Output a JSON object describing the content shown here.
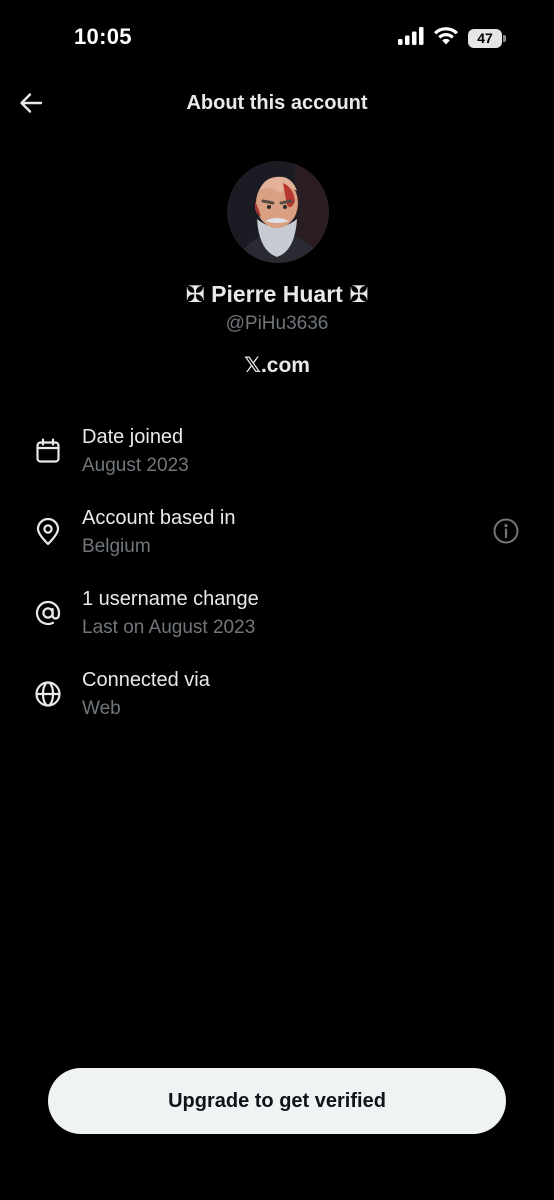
{
  "status_bar": {
    "time": "10:05",
    "battery_percent": "47",
    "signal_icon": "cellular-signal-icon",
    "wifi_icon": "wifi-icon"
  },
  "header": {
    "title": "About this account",
    "back_icon": "arrow-left-icon"
  },
  "profile": {
    "display_name": "✠ Pierre Huart ✠",
    "handle": "@PiHu3636",
    "source": "𝕏.com"
  },
  "info_rows": [
    {
      "icon": "calendar-icon",
      "title": "Date joined",
      "subtitle": "August 2023"
    },
    {
      "icon": "location-pin-icon",
      "title": "Account based in",
      "subtitle": "Belgium",
      "extra_icon": "info-circle-icon"
    },
    {
      "icon": "at-sign-icon",
      "title": "1 username change",
      "subtitle": "Last on August 2023"
    },
    {
      "icon": "globe-icon",
      "title": "Connected via",
      "subtitle": "Web"
    }
  ],
  "footer": {
    "upgrade_label": "Upgrade to get verified"
  },
  "colors": {
    "background": "#000000",
    "primary_text": "#e7e9ea",
    "secondary_text": "#71767b",
    "button_bg": "#eff3f4",
    "button_text": "#0f1419"
  }
}
